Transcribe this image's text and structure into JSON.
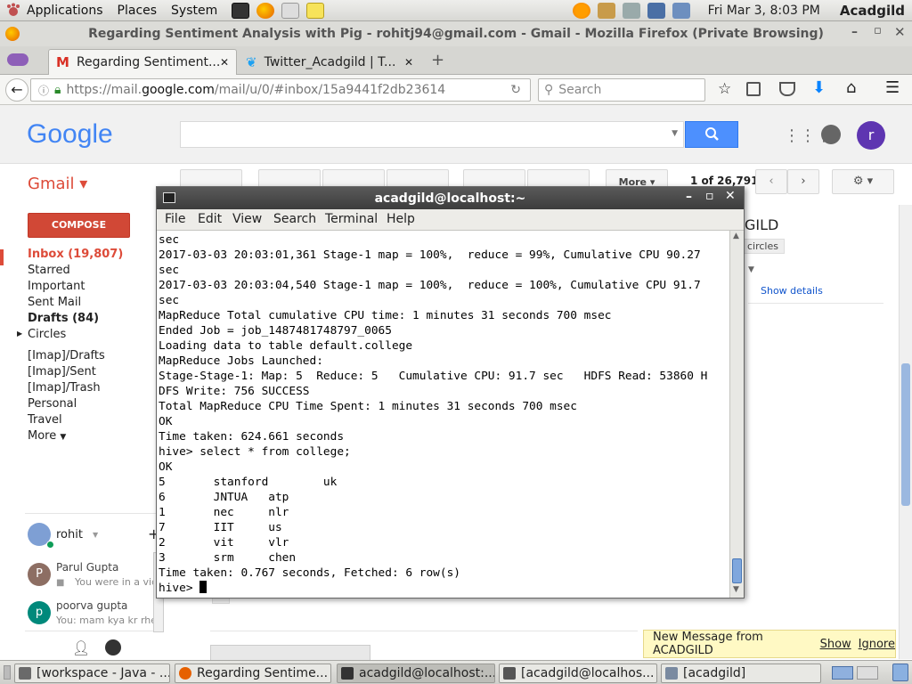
{
  "top_panel": {
    "menus": [
      "Applications",
      "Places",
      "System"
    ],
    "clock": "Fri Mar  3,  8:03 PM",
    "user": "Acadgild"
  },
  "firefox": {
    "window_title": "Regarding Sentiment Analysis with Pig - rohitj94@gmail.com - Gmail - Mozilla Firefox (Private Browsing)",
    "tabs": [
      {
        "label": "Regarding Sentiment...",
        "icon": "gmail-icon"
      },
      {
        "label": "Twitter_Acadgild | T...",
        "icon": "twitter-icon"
      }
    ],
    "url_prefix": "https://mail.",
    "url_domain": "google.com",
    "url_rest": "/mail/u/0/#inbox/15a9441f2db23614",
    "search_placeholder": "Search"
  },
  "gmail": {
    "logo": "Google",
    "app_label": "Gmail",
    "compose": "COMPOSE",
    "nav": [
      {
        "label": "Inbox (19,807)"
      },
      {
        "label": "Starred"
      },
      {
        "label": "Important"
      },
      {
        "label": "Sent Mail"
      },
      {
        "label": "Drafts (84)"
      },
      {
        "label": "Circles"
      },
      {
        "label": "[Imap]/Drafts"
      },
      {
        "label": "[Imap]/Sent"
      },
      {
        "label": "[Imap]/Trash"
      },
      {
        "label": "Personal"
      },
      {
        "label": "Travel"
      },
      {
        "label": "More"
      }
    ],
    "more_button": "More",
    "pagination": "1 of 26,791",
    "avatar_letter": "r",
    "right_heading": "GILD",
    "circles_badge": "circles",
    "show_details": "Show details",
    "hangouts_user": "rohit",
    "contacts": [
      {
        "name": "Parul Gupta",
        "letter": "P",
        "status": "You were in a vide",
        "color": "#8d6e63"
      },
      {
        "name": "poorva gupta",
        "letter": "p",
        "status": "You: mam kya kr rhe h",
        "color": "#00897b"
      }
    ]
  },
  "terminal": {
    "title": "acadgild@localhost:~",
    "menu": [
      "File",
      "Edit",
      "View",
      "Search",
      "Terminal",
      "Help"
    ],
    "lines": [
      "sec",
      "2017-03-03 20:03:01,361 Stage-1 map = 100%,  reduce = 99%, Cumulative CPU 90.27",
      "sec",
      "2017-03-03 20:03:04,540 Stage-1 map = 100%,  reduce = 100%, Cumulative CPU 91.7",
      "sec",
      "MapReduce Total cumulative CPU time: 1 minutes 31 seconds 700 msec",
      "Ended Job = job_1487481748797_0065",
      "Loading data to table default.college",
      "MapReduce Jobs Launched:",
      "Stage-Stage-1: Map: 5  Reduce: 5   Cumulative CPU: 91.7 sec   HDFS Read: 53860 H",
      "DFS Write: 756 SUCCESS",
      "Total MapReduce CPU Time Spent: 1 minutes 31 seconds 700 msec",
      "OK",
      "Time taken: 624.661 seconds",
      "hive> select * from college;",
      "OK",
      "5       stanford        uk",
      "6       JNTUA   atp",
      "1       nec     nlr",
      "7       IIT     us",
      "2       vit     vlr",
      "3       srm     chen",
      "Time taken: 0.767 seconds, Fetched: 6 row(s)",
      "hive> "
    ]
  },
  "notification": {
    "text": "New Message from ACADGILD",
    "show": "Show",
    "ignore": "Ignore"
  },
  "taskbar": [
    {
      "label": "[workspace - Java - ...",
      "icon_color": "#6a6a6a"
    },
    {
      "label": "Regarding Sentime...",
      "icon_color": "#e66000"
    },
    {
      "label": "acadgild@localhost:...",
      "icon_color": "#333"
    },
    {
      "label": "[acadgild@localhos...",
      "icon_color": "#555"
    },
    {
      "label": "[acadgild]",
      "icon_color": "#7a8aa0"
    }
  ]
}
